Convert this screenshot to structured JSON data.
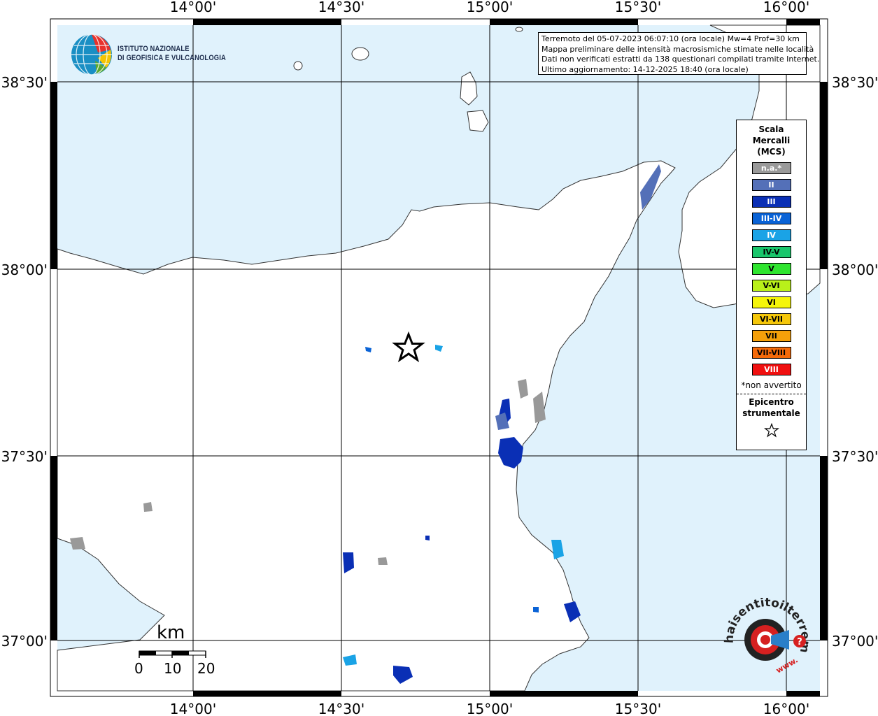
{
  "info": {
    "line1": "Terremoto del 05-07-2023 06:07:10 (ora locale) Mw=4 Prof=30 km",
    "line2": "Mappa preliminare delle intensità macrosismiche stimate nelle località",
    "line3": "Dati non verificati estratti da 138 questionari compilati tramite Internet.",
    "line4": "Ultimo aggiornamento: 14-12-2025 18:40 (ora locale)"
  },
  "logo": {
    "line1": "ISTITUTO NAZIONALE",
    "line2": "DI GEOFISICA E VULCANOLOGIA"
  },
  "axes": {
    "lon_top": [
      "14°00'",
      "14°30'",
      "15°00'",
      "15°30'",
      "16°00'"
    ],
    "lon_bottom": [
      "14°00'",
      "14°30'",
      "15°00'",
      "15°30'",
      "16°00'"
    ],
    "lat_left": [
      "38°30'",
      "38°00'",
      "37°30'",
      "37°00'"
    ],
    "lat_right": [
      "38°30'",
      "38°00'",
      "37°30'",
      "37°00'"
    ]
  },
  "legend": {
    "title_line1": "Scala",
    "title_line2": "Mercalli",
    "title_line3": "(MCS)",
    "items": [
      {
        "label": "n.a.*",
        "color": "#999999",
        "text_color": "#ffffff"
      },
      {
        "label": "II",
        "color": "#5470b8",
        "text_color": "#ffffff"
      },
      {
        "label": "III",
        "color": "#0a2fb5",
        "text_color": "#ffffff"
      },
      {
        "label": "III-IV",
        "color": "#0a63d6",
        "text_color": "#ffffff"
      },
      {
        "label": "IV",
        "color": "#1aa3e6",
        "text_color": "#ffffff"
      },
      {
        "label": "IV-V",
        "color": "#19c66b",
        "text_color": "#000000"
      },
      {
        "label": "V",
        "color": "#2fe52f",
        "text_color": "#000000"
      },
      {
        "label": "V-VI",
        "color": "#b9f01a",
        "text_color": "#000000"
      },
      {
        "label": "VI",
        "color": "#f5f50a",
        "text_color": "#000000"
      },
      {
        "label": "VI-VII",
        "color": "#f5c70a",
        "text_color": "#000000"
      },
      {
        "label": "VII",
        "color": "#f5a00a",
        "text_color": "#000000"
      },
      {
        "label": "VII-VIII",
        "color": "#f56a0a",
        "text_color": "#000000"
      },
      {
        "label": "VIII",
        "color": "#f01010",
        "text_color": "#ffffff"
      }
    ],
    "note": "*non avvertito",
    "epicenter_line1": "Epicentro",
    "epicenter_line2": "strumentale",
    "epicenter_symbol": "☆"
  },
  "scale_bar": {
    "unit": "km",
    "ticks": [
      "0",
      "10",
      "20"
    ]
  },
  "hst_logo": {
    "text": "haisentitoilterremoto.it",
    "prefix": "www.",
    "question": "?"
  },
  "colors": {
    "sea": "#e0f2fc",
    "land": "#ffffff",
    "grid": "#000000"
  }
}
